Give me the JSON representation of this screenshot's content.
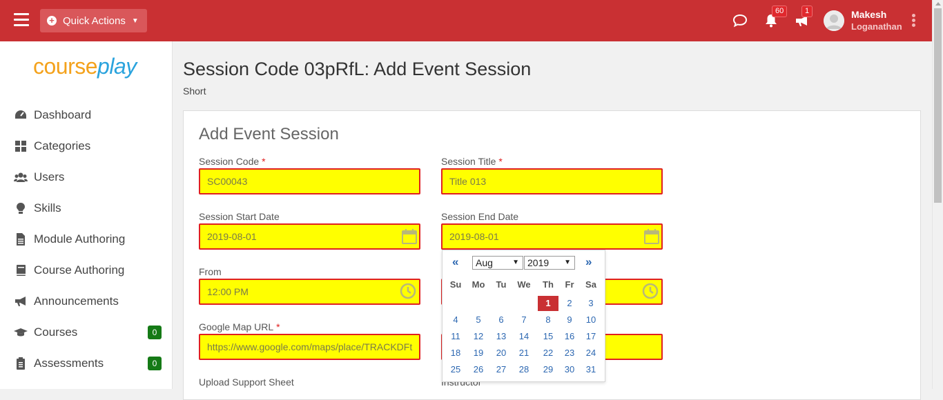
{
  "topbar": {
    "quick_actions_label": "Quick Actions",
    "notifications_count": "60",
    "announcements_count": "1",
    "user_first": "Makesh",
    "user_last": "Loganathan"
  },
  "sidebar": {
    "logo_course": "course",
    "logo_play": "play",
    "items": [
      {
        "label": "Dashboard",
        "icon": "dashboard-icon"
      },
      {
        "label": "Categories",
        "icon": "categories-icon"
      },
      {
        "label": "Users",
        "icon": "users-icon"
      },
      {
        "label": "Skills",
        "icon": "skills-icon"
      },
      {
        "label": "Module Authoring",
        "icon": "module-icon"
      },
      {
        "label": "Course Authoring",
        "icon": "book-icon"
      },
      {
        "label": "Announcements",
        "icon": "megaphone-icon"
      },
      {
        "label": "Courses",
        "icon": "graduation-cap-icon",
        "count": "0"
      },
      {
        "label": "Assessments",
        "icon": "clipboard-icon",
        "count": "0"
      }
    ]
  },
  "page": {
    "title": "Session Code 03pRfL: Add Event Session",
    "subtitle": "Short"
  },
  "form": {
    "title": "Add Event Session",
    "required_mark": "*",
    "session_code_label": "Session Code",
    "session_code_value": "SC00043",
    "session_title_label": "Session Title",
    "session_title_value": "Title 013",
    "start_date_label": "Session Start Date",
    "start_date_value": "2019-08-01",
    "end_date_label": "Session End Date",
    "end_date_value": "2019-08-01",
    "from_label": "From",
    "from_value": "12:00 PM",
    "map_url_label": "Google Map URL",
    "map_url_value": "https://www.google.com/maps/place/TRACKDFt",
    "upload_label": "Upload Support Sheet",
    "instructor_label": "Instructor"
  },
  "datepicker": {
    "prev": "«",
    "next": "»",
    "month": "Aug",
    "year": "2019",
    "weekdays": [
      "Su",
      "Mo",
      "Tu",
      "We",
      "Th",
      "Fr",
      "Sa"
    ],
    "selected_day": "1",
    "weeks": [
      [
        "",
        "",
        "",
        "",
        "1",
        "2",
        "3"
      ],
      [
        "4",
        "5",
        "6",
        "7",
        "8",
        "9",
        "10"
      ],
      [
        "11",
        "12",
        "13",
        "14",
        "15",
        "16",
        "17"
      ],
      [
        "18",
        "19",
        "20",
        "21",
        "22",
        "23",
        "24"
      ],
      [
        "25",
        "26",
        "27",
        "28",
        "29",
        "30",
        "31"
      ]
    ]
  },
  "colors": {
    "brand_red": "#c93033",
    "field_fill": "#ffff00",
    "field_border": "#e02020",
    "count_green": "#157a16"
  }
}
